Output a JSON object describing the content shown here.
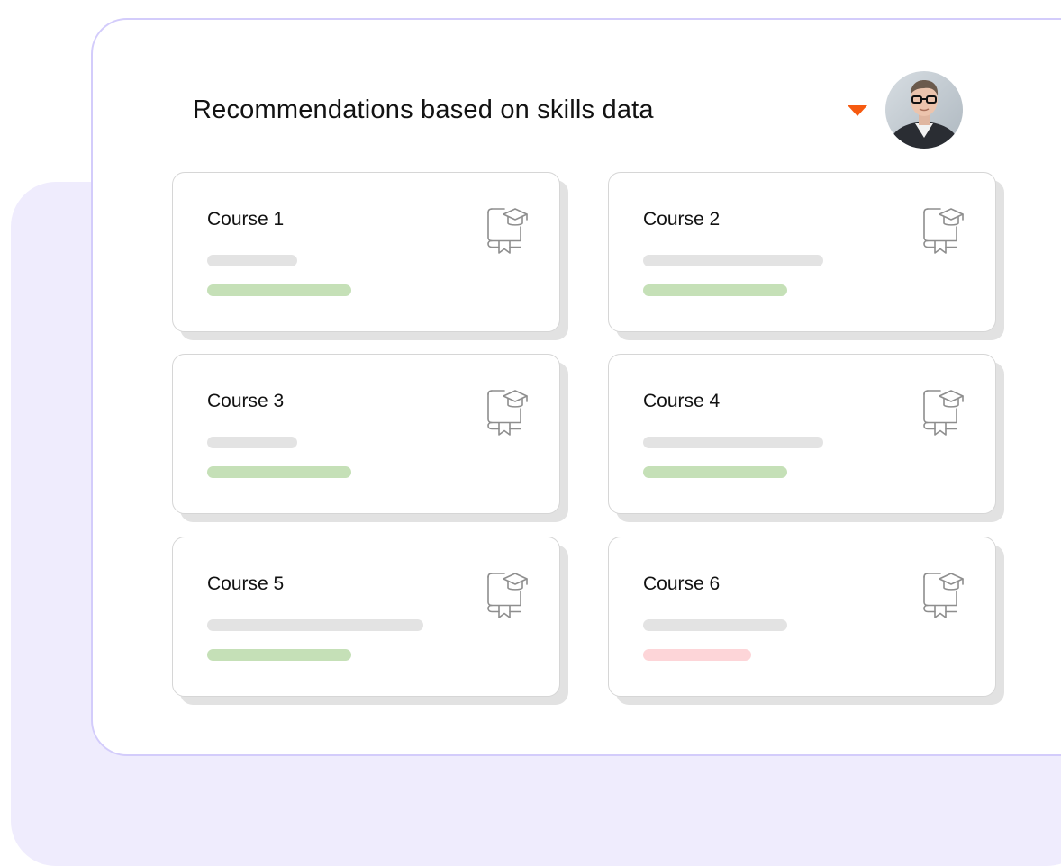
{
  "header": {
    "title": "Recommendations based on skills data",
    "dropdown_icon": "caret-down-icon",
    "avatar_icon": "user-avatar"
  },
  "colors": {
    "accent": "#f65a10",
    "panel_border": "#d3ccfb",
    "backdrop": "#efecfd",
    "bar_neutral": "#e3e3e3",
    "bar_positive": "#c5e0b7",
    "bar_negative": "#fdd5d8"
  },
  "courses": [
    {
      "title": "Course 1",
      "icon": "certificate-graduation-icon",
      "grey_bar_fraction": 0.25,
      "status_bar_fraction": 0.4,
      "status": "positive"
    },
    {
      "title": "Course 2",
      "icon": "certificate-graduation-icon",
      "grey_bar_fraction": 0.5,
      "status_bar_fraction": 0.4,
      "status": "positive"
    },
    {
      "title": "Course 3",
      "icon": "certificate-graduation-icon",
      "grey_bar_fraction": 0.25,
      "status_bar_fraction": 0.4,
      "status": "positive"
    },
    {
      "title": "Course 4",
      "icon": "certificate-graduation-icon",
      "grey_bar_fraction": 0.5,
      "status_bar_fraction": 0.4,
      "status": "positive"
    },
    {
      "title": "Course 5",
      "icon": "certificate-graduation-icon",
      "grey_bar_fraction": 0.6,
      "status_bar_fraction": 0.4,
      "status": "positive"
    },
    {
      "title": "Course 6",
      "icon": "certificate-graduation-icon",
      "grey_bar_fraction": 0.4,
      "status_bar_fraction": 0.3,
      "status": "negative"
    }
  ]
}
